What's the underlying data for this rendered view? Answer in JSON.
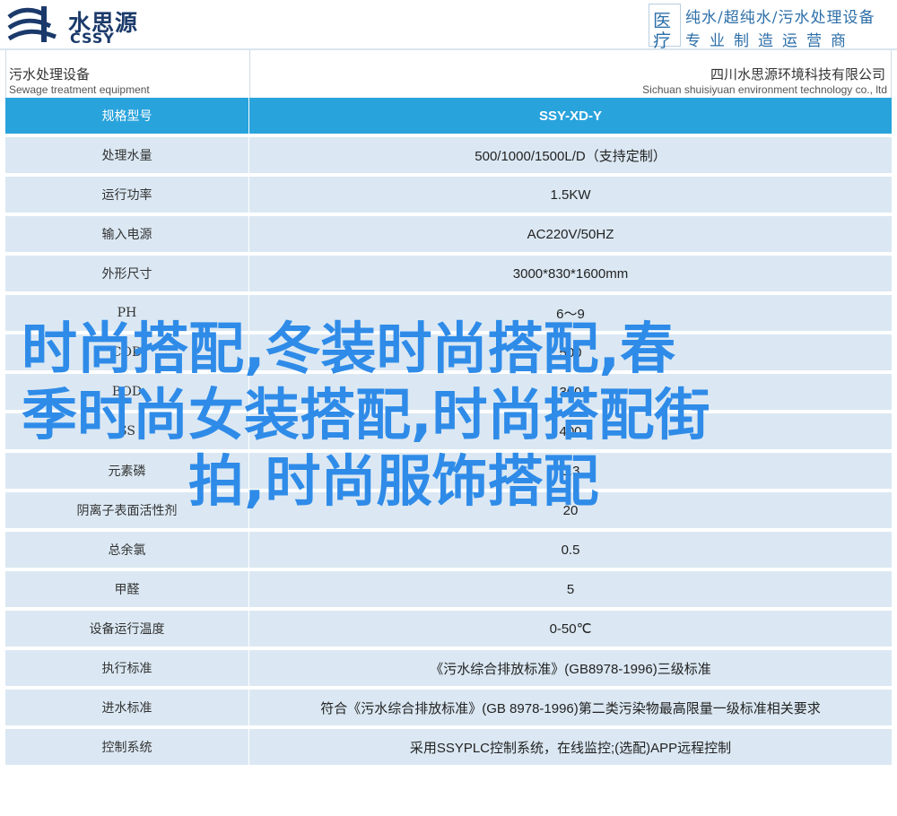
{
  "header": {
    "logo_cn": "水思源",
    "logo_en": "CSSY",
    "badge_line1": "医",
    "badge_line2": "疗",
    "right_line1": "纯水/超纯水/污水处理设备",
    "right_line2": "专业制造运营商"
  },
  "subheader": {
    "left_cn": "污水处理设备",
    "left_en": "Sewage treatment equipment",
    "right_cn": "四川水思源环境科技有限公司",
    "right_en": "Sichuan shuisiyuan environment technology co., ltd"
  },
  "table": {
    "head": {
      "key": "规格型号",
      "value": "SSY-XD-Y"
    },
    "rows": [
      {
        "key": "处理水量",
        "value": "500/1000/1500L/D（支持定制）"
      },
      {
        "key": "运行功率",
        "value": "1.5KW"
      },
      {
        "key": "输入电源",
        "value": "AC220V/50HZ"
      },
      {
        "key": "外形尺寸",
        "value": "3000*830*1600mm"
      },
      {
        "key": "PH",
        "value": "6～9"
      },
      {
        "key": "COD",
        "value": "500"
      },
      {
        "key": "BOD",
        "value": "300"
      },
      {
        "key": "SS",
        "value": "400"
      },
      {
        "key": "元素磷",
        "value": "0.3"
      },
      {
        "key": "阴离子表面活性剂",
        "value": "20"
      },
      {
        "key": "总余氯",
        "value": "0.5"
      },
      {
        "key": "甲醛",
        "value": "5"
      },
      {
        "key": "设备运行温度",
        "value": "0-50℃"
      },
      {
        "key": "执行标准",
        "value": "《污水综合排放标准》(GB8978-1996)三级标准"
      },
      {
        "key": "进水标准",
        "value": "符合《污水综合排放标准》(GB 8978-1996)第二类污染物最高限量一级标准相关要求"
      },
      {
        "key": "控制系统",
        "value": "采用SSYPLC控制系统，在线监控;(选配)APP远程控制"
      }
    ]
  },
  "overlay": {
    "line1": "时尚搭配,冬装时尚搭配,春",
    "line2": "季时尚女装搭配,时尚搭配街",
    "line3": "拍,时尚服饰搭配"
  },
  "colors": {
    "header_row": "#29a3dc",
    "row_bg": "#dbe8f3",
    "overlay_text": "#2f8be8",
    "brand": "#1b3a6b"
  }
}
